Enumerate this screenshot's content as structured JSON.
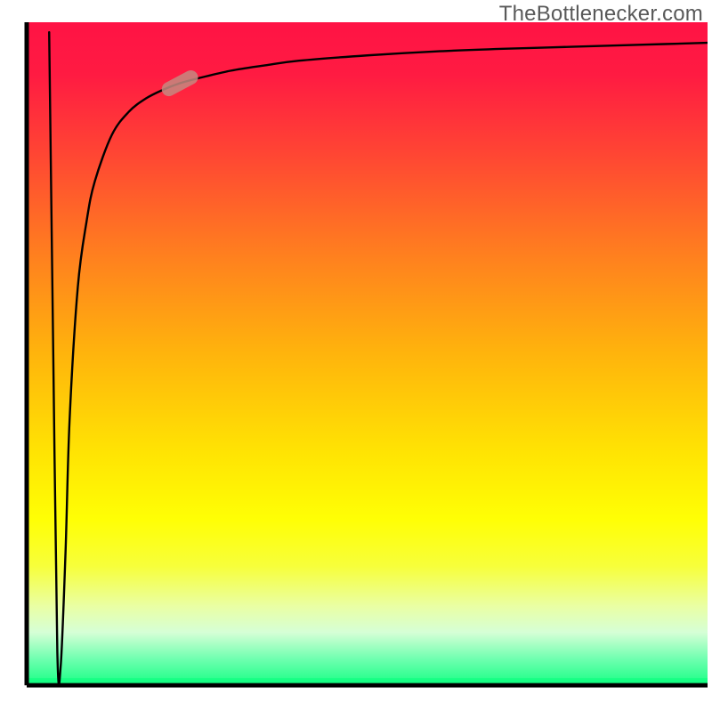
{
  "watermark": "TheBottlenecker.com",
  "colors": {
    "curve": "#000000",
    "marker_fill": "#c48a80",
    "marker_fill_opacity": 0.85,
    "axis": "#000000",
    "gradient_stops": [
      {
        "offset": 0.0,
        "color": "#ff1345"
      },
      {
        "offset": 0.08,
        "color": "#ff1b42"
      },
      {
        "offset": 0.2,
        "color": "#ff4633"
      },
      {
        "offset": 0.35,
        "color": "#ff7f1f"
      },
      {
        "offset": 0.5,
        "color": "#ffb40c"
      },
      {
        "offset": 0.65,
        "color": "#ffe403"
      },
      {
        "offset": 0.75,
        "color": "#ffff05"
      },
      {
        "offset": 0.82,
        "color": "#f7ff3a"
      },
      {
        "offset": 0.88,
        "color": "#eaffa3"
      },
      {
        "offset": 0.92,
        "color": "#d6ffd6"
      },
      {
        "offset": 0.96,
        "color": "#70ffb0"
      },
      {
        "offset": 1.0,
        "color": "#17ff84"
      }
    ]
  },
  "chart_data": {
    "type": "line",
    "title": "",
    "xlabel": "",
    "ylabel": "",
    "xlim": [
      0,
      100
    ],
    "ylim": [
      0,
      100
    ],
    "grid": false,
    "legend": false,
    "note": "Values are estimated from pixel positions of the plotted curve; the chart in the image has no numeric tick labels.",
    "series": [
      {
        "name": "bottleneck-curve",
        "description": "Curve that drops sharply to near zero then rises asymptotically toward ~97",
        "x": [
          3.3,
          3.9,
          4.5,
          5.0,
          5.7,
          6.3,
          7.5,
          8.8,
          10.0,
          12.5,
          15.0,
          17.5,
          20.0,
          22.5,
          25.0,
          30.0,
          35.0,
          40.0,
          50.0,
          60.0,
          70.0,
          80.0,
          90.0,
          100.0
        ],
        "y": [
          98.5,
          50.0,
          5.0,
          3.0,
          20.0,
          40.0,
          60.0,
          70.0,
          76.0,
          83.0,
          86.5,
          88.5,
          89.8,
          90.8,
          91.5,
          92.7,
          93.5,
          94.2,
          95.0,
          95.6,
          96.0,
          96.3,
          96.6,
          96.9
        ]
      }
    ],
    "marker": {
      "series": "bottleneck-curve",
      "x": 22.5,
      "y": 90.8,
      "shape": "rounded-capsule",
      "angle_deg_from_horizontal": 28
    }
  }
}
